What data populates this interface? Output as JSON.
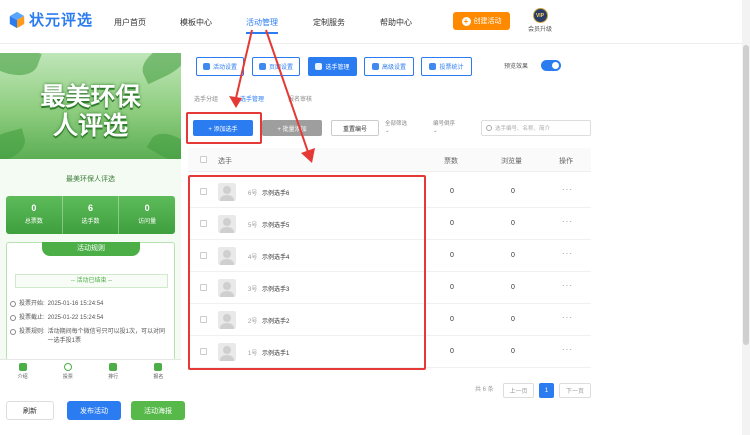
{
  "brand": {
    "name": "状元评选"
  },
  "nav": {
    "items": [
      "用户首页",
      "模板中心",
      "活动管理",
      "定制服务",
      "帮助中心"
    ],
    "active": "活动管理"
  },
  "header": {
    "create_button": "创建活动",
    "vip_badge": "VIP",
    "vip_label": "会员升级"
  },
  "preview": {
    "banner_line1": "最美环保",
    "banner_line2": "人评选",
    "event_name": "最美环保人评选",
    "stats": [
      {
        "value": "0",
        "label": "总票数"
      },
      {
        "value": "6",
        "label": "选手数"
      },
      {
        "value": "0",
        "label": "访问量"
      }
    ],
    "rules_title": "活动规则",
    "status_text": "-- 活动已结束 --",
    "rules": [
      {
        "label": "投票开始:",
        "text": "2025-01-16 15:24:54"
      },
      {
        "label": "投票截止:",
        "text": "2025-01-22 15:24:54"
      },
      {
        "label": "投票规则:",
        "text": "活动期间每个微信号只可以投1次，可以对同一选手投1票"
      }
    ],
    "bottom_nav": [
      "介绍",
      "投票",
      "排行",
      "报名"
    ]
  },
  "left_actions": {
    "refresh": "刷新",
    "publish": "发布活动",
    "poster": "活动海报"
  },
  "tabs": [
    {
      "label": "活动设置",
      "active": false
    },
    {
      "label": "页面设置",
      "active": false
    },
    {
      "label": "选手管理",
      "active": true
    },
    {
      "label": "高级设置",
      "active": false
    },
    {
      "label": "投票统计",
      "active": false
    }
  ],
  "preview_toggle": {
    "label": "预览效果",
    "on": true
  },
  "subtabs": [
    {
      "label": "选手分组",
      "active": false
    },
    {
      "label": "选手管理",
      "active": true
    },
    {
      "label": "报名审核",
      "active": false
    }
  ],
  "toolbar": {
    "add_button": "+ 添加选手",
    "batch_button": "+ 批量添加",
    "renumber_button": "重置编号",
    "filter_all": "全部筛选",
    "filter_number": "编号倒序",
    "search_placeholder": "选手编号、名称、简介"
  },
  "table": {
    "columns": [
      "选手",
      "票数",
      "浏览量",
      "操作"
    ],
    "rows": [
      {
        "number": "6号",
        "name": "示例选手6",
        "votes": "0",
        "views": "0",
        "action": "···"
      },
      {
        "number": "5号",
        "name": "示例选手5",
        "votes": "0",
        "views": "0",
        "action": "···"
      },
      {
        "number": "4号",
        "name": "示例选手4",
        "votes": "0",
        "views": "0",
        "action": "···"
      },
      {
        "number": "3号",
        "name": "示例选手3",
        "votes": "0",
        "views": "0",
        "action": "···"
      },
      {
        "number": "2号",
        "name": "示例选手2",
        "votes": "0",
        "views": "0",
        "action": "···"
      },
      {
        "number": "1号",
        "name": "示例选手1",
        "votes": "0",
        "views": "0",
        "action": "···"
      }
    ]
  },
  "pagination": {
    "total": "共 6 条",
    "prev": "上一页",
    "current": "1",
    "next": "下一页"
  },
  "colors": {
    "primary": "#2b7cf0",
    "orange": "#ff8a00",
    "green": "#4cae47",
    "annotation_red": "#e53935"
  }
}
